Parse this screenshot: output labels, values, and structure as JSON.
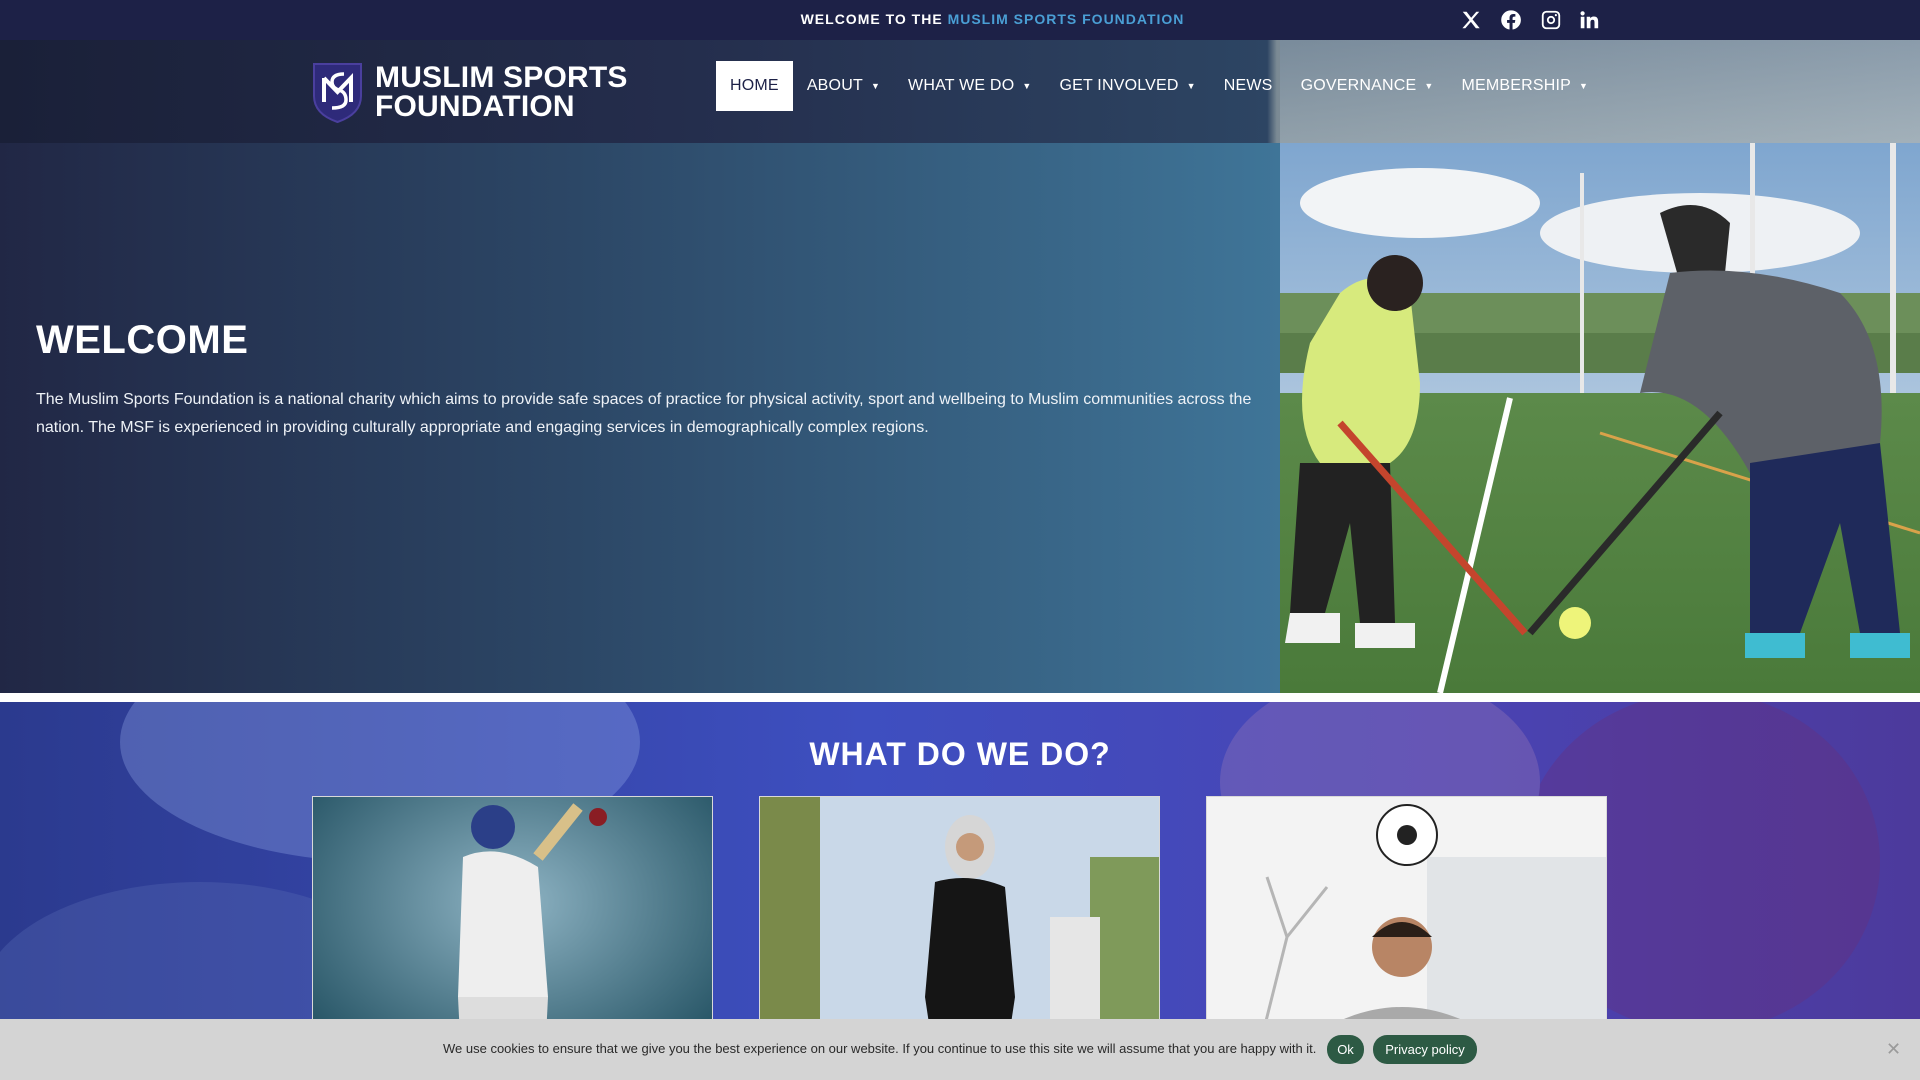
{
  "topbar": {
    "welcome_prefix": "WELCOME TO THE",
    "welcome_accent": "MUSLIM SPORTS FOUNDATION",
    "social": [
      "x-icon",
      "facebook-icon",
      "instagram-icon",
      "linkedin-icon"
    ]
  },
  "header": {
    "logo_line1": "MUSLIM SPORTS",
    "logo_line2": "FOUNDATION"
  },
  "nav": {
    "items": [
      {
        "label": "HOME",
        "active": true,
        "dropdown": false
      },
      {
        "label": "ABOUT",
        "dropdown": true
      },
      {
        "label": "WHAT WE DO",
        "dropdown": true
      },
      {
        "label": "GET INVOLVED",
        "dropdown": true
      },
      {
        "label": "NEWS",
        "dropdown": false
      },
      {
        "label": "GOVERNANCE",
        "dropdown": true
      },
      {
        "label": "MEMBERSHIP",
        "dropdown": true
      }
    ]
  },
  "hero": {
    "title": "WELCOME",
    "body": "The Muslim Sports Foundation is a national charity which aims to provide safe spaces of practice for physical activity, sport and wellbeing to Muslim communities across the nation. The MSF is experienced in providing culturally appropriate and engaging services in demographically complex regions."
  },
  "section2": {
    "title": "WHAT DO WE DO?"
  },
  "cookie": {
    "text": "We use cookies to ensure that we give you the best experience on our website. If you continue to use this site we will assume that you are happy with it.",
    "ok_label": "Ok",
    "privacy_label": "Privacy policy",
    "close_glyph": "✕"
  },
  "colors": {
    "topbar": "#1d2147",
    "accent": "#4a9fd5",
    "cookie_button": "#2d5a44"
  }
}
